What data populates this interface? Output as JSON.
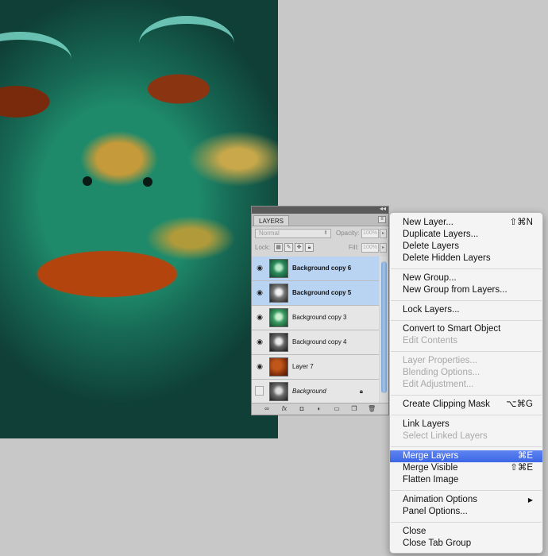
{
  "panel": {
    "tab_label": "LAYERS",
    "blend_mode": "Normal",
    "opacity_label": "Opacity:",
    "opacity_value": "100%",
    "lock_label": "Lock:",
    "fill_label": "Fill:",
    "fill_value": "100%",
    "layers": [
      {
        "name": "Background copy 6",
        "selected": true
      },
      {
        "name": "Background copy 5",
        "selected": true
      },
      {
        "name": "Background copy 3",
        "selected": false
      },
      {
        "name": "Background copy 4",
        "selected": false
      },
      {
        "name": "Layer 7",
        "selected": false
      },
      {
        "name": "Background",
        "selected": false,
        "italic": true,
        "locked": true
      }
    ]
  },
  "menu": {
    "items": [
      {
        "label": "New Layer...",
        "shortcut": "⇧⌘N"
      },
      {
        "label": "Duplicate Layers..."
      },
      {
        "label": "Delete Layers"
      },
      {
        "label": "Delete Hidden Layers"
      },
      {
        "label": "New Group..."
      },
      {
        "label": "New Group from Layers..."
      },
      {
        "label": "Lock Layers..."
      },
      {
        "label": "Convert to Smart Object"
      },
      {
        "label": "Edit Contents",
        "disabled": true
      },
      {
        "label": "Layer Properties...",
        "disabled": true
      },
      {
        "label": "Blending Options...",
        "disabled": true
      },
      {
        "label": "Edit Adjustment...",
        "disabled": true
      },
      {
        "label": "Create Clipping Mask",
        "shortcut": "⌥⌘G"
      },
      {
        "label": "Link Layers"
      },
      {
        "label": "Select Linked Layers",
        "disabled": true
      },
      {
        "label": "Merge Layers",
        "shortcut": "⌘E",
        "highlighted": true
      },
      {
        "label": "Merge Visible",
        "shortcut": "⇧⌘E"
      },
      {
        "label": "Flatten Image"
      },
      {
        "label": "Animation Options",
        "shortcut": "▶"
      },
      {
        "label": "Panel Options..."
      },
      {
        "label": "Close"
      },
      {
        "label": "Close Tab Group"
      }
    ]
  },
  "colors": {
    "menu_highlight": "#3b66e6",
    "selected_layer": "#b9d4f2",
    "workspace": "#c8c8c8"
  }
}
